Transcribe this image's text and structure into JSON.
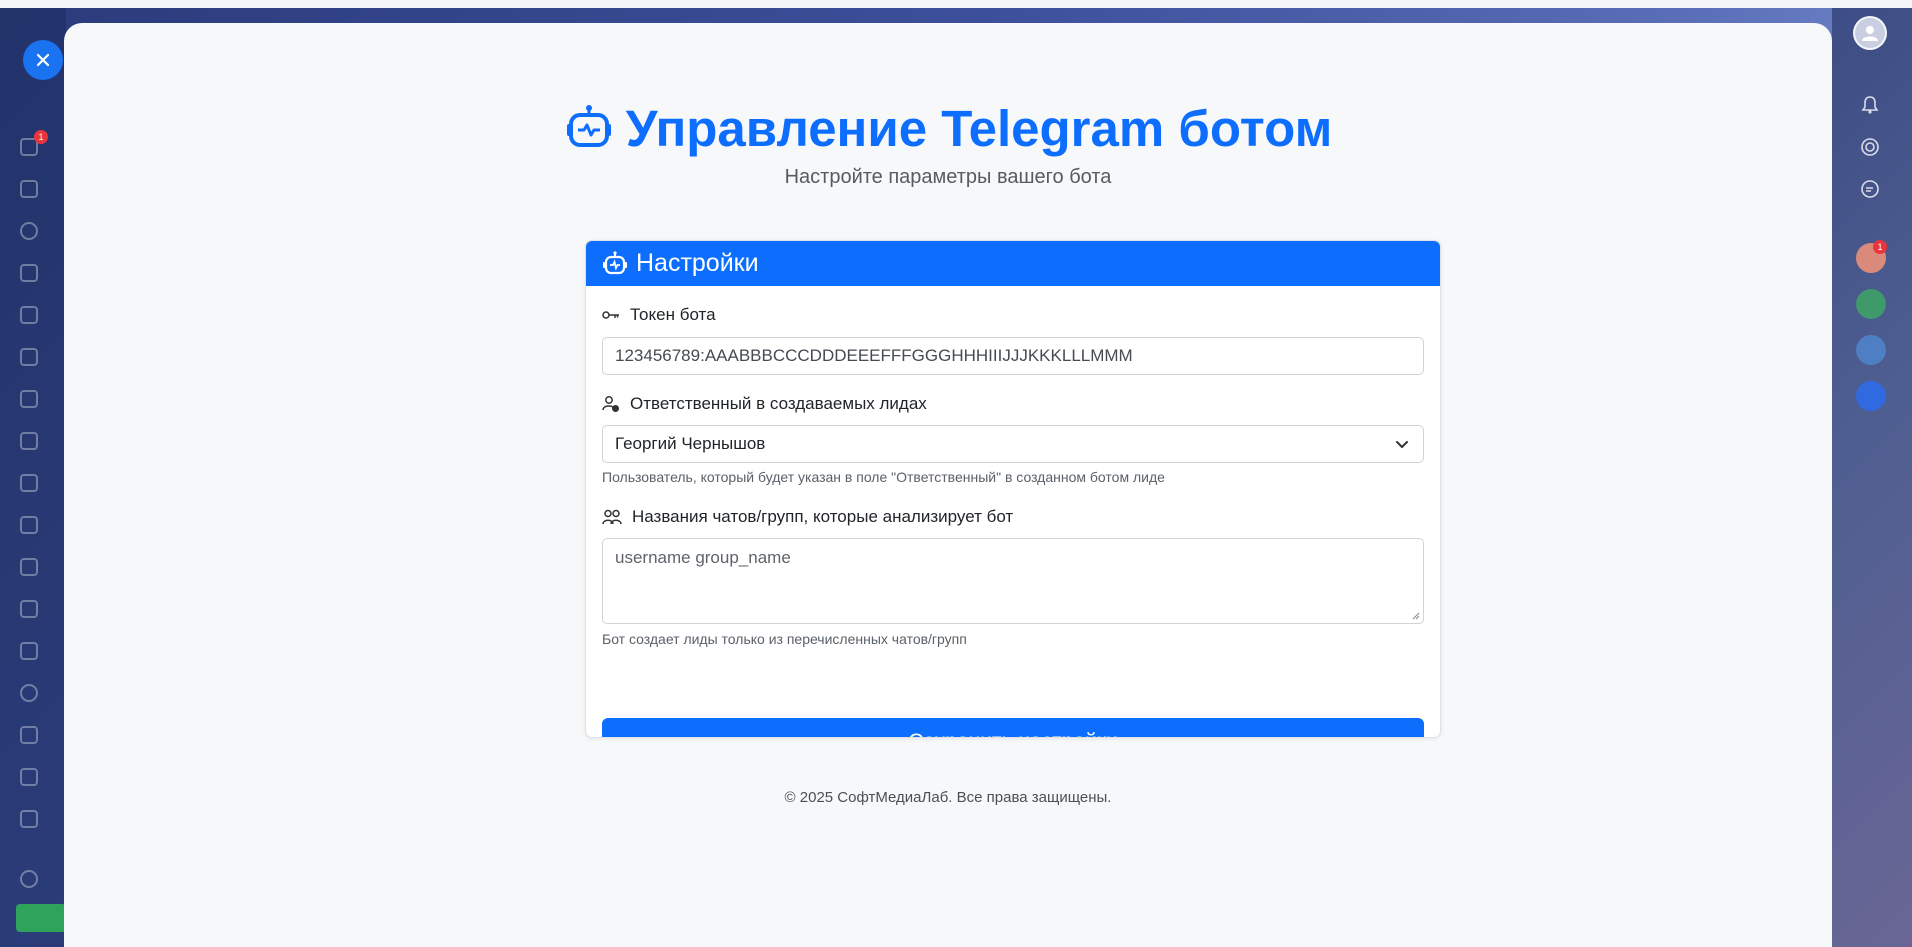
{
  "page": {
    "title": "Управление Telegram ботом",
    "subtitle": "Настройте параметры вашего бота"
  },
  "card": {
    "header": "Настройки",
    "token": {
      "label": "Токен бота",
      "value": "123456789:AAABBBCCCDDDEEEFFFGGGHHHIIIJJJKKKLLLMMM"
    },
    "responsible": {
      "label": "Ответственный в создаваемых лидах",
      "selected": "Георгий Чернышов",
      "help": "Пользователь, который будет указан в поле \"Ответственный\" в созданном ботом лиде"
    },
    "chats": {
      "label": "Названия чатов/групп, которые анализирует бот",
      "placeholder": "username group_name",
      "help": "Бот создает лиды только из перечисленных чатов/групп"
    },
    "save_label": "Сохранить настройки"
  },
  "footer": "© 2025 СофтМедиаЛаб. Все права защищены.",
  "right_sidebar": {
    "avatar_badge": "1"
  },
  "left_sidebar": {
    "badge": "1"
  },
  "colors": {
    "accent": "#0d6efd",
    "background": "#f7f8fa"
  },
  "icons": [
    "robot-icon",
    "key-icon",
    "person-badge-icon",
    "people-icon",
    "chevron-down-icon",
    "close-icon",
    "bell-icon"
  ]
}
